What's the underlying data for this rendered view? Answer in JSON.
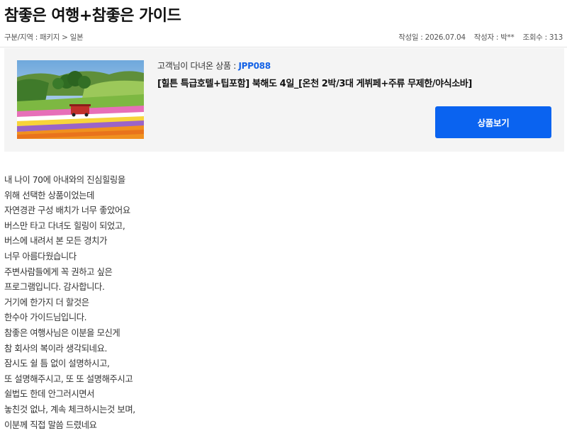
{
  "review": {
    "title": "참좋은 여행+참좋은 가이드",
    "breadcrumb": "구분/지역 : 패키지 > 일본",
    "date_label": "작성일 : 2026.07.04",
    "author_label": "작성자 : 박**",
    "views_label": "조회수 : 313"
  },
  "product": {
    "prefix": "고객님이 다녀온 상품 : ",
    "code": "JPP088",
    "name": "[힐튼 특급호텔+팁포함] 북해도 4일_[온천 2박/3대 게뷔페+주류 무제한/야식소바]",
    "button_label": "상품보기"
  },
  "body_lines": [
    "내 나이 70에 아내와의 진심힐링을",
    "위해 선택한 상품이었는데",
    "자연경관 구성 배치가 너무 좋았어요",
    "버스만 타고 다녀도 힐링이 되었고,",
    "버스에 내려서 본 모든 경치가",
    "너무 아름다웠습니다",
    "주변사람들에게 꼭 권하고 싶은",
    "프로그램입니다. 감사합니다.",
    "거기에 한가지 더 할것은",
    "한수아 가이드님입니다.",
    "참좋은 여행사님은 이분을 모신게",
    "참 회사의 복이라 생각되네요.",
    "잠시도 쉴 틈 없이 설명하시고,",
    "또 설명해주시고, 또 또 설명해주시고",
    "쉴법도 한데 안그러시면서",
    "놓친것 없나, 계속 체크하시는것 보며,",
    "이분께 직접 말씀 드렸네요"
  ],
  "colors": {
    "accent": "#0a63f0",
    "code_text": "#1462e6",
    "panel_bg": "#f4f4f4"
  }
}
